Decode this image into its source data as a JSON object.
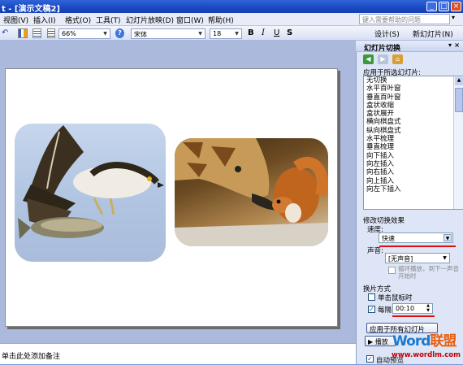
{
  "window": {
    "title": "t - [演示文稿2]",
    "min": "_",
    "max": "□",
    "close": "×"
  },
  "menu": [
    "视图(V)",
    "插入(I)",
    "格式(O)",
    "工具(T)",
    "幻灯片放映(D)",
    "窗口(W)",
    "帮助(H)"
  ],
  "help_placeholder": "键入需要帮助的问题",
  "toolbar": {
    "zoom": "66%",
    "font": "宋体",
    "size": "18",
    "bold": "B",
    "italic": "I",
    "underline": "U",
    "shadow": "S",
    "design": "设计(S)",
    "new_slide": "新幻灯片(N)"
  },
  "pane": {
    "title": "幻灯片切换",
    "apply_label": "应用于所选幻灯片:",
    "transitions": [
      "无切换",
      "水平百叶窗",
      "垂直百叶窗",
      "盒状收缩",
      "盒状展开",
      "横向棋盘式",
      "纵向棋盘式",
      "水平梳理",
      "垂直梳理",
      "向下插入",
      "向左插入",
      "向右插入",
      "向上插入",
      "向左下插入"
    ],
    "modify_label": "修改切换效果",
    "speed_label": "速度:",
    "speed_value": "快速",
    "sound_label": "声音:",
    "sound_value": "[无声音]",
    "loop_label": "循环播放，到下一声音开始时",
    "advance_label": "换片方式",
    "on_click": "单击鼠标时",
    "every": "每隔",
    "time_value": "00:10",
    "apply_all": "应用于所有幻灯片",
    "auto_preview": "自动预览",
    "play": "播放"
  },
  "notes_placeholder": "单击此处添加备注",
  "watermark": {
    "word": "Word",
    "lianmeng": "联盟",
    "url": "www.wordlm.com"
  },
  "colors": {
    "accent_red": "#e01010",
    "title_blue": "#1a48c0"
  }
}
